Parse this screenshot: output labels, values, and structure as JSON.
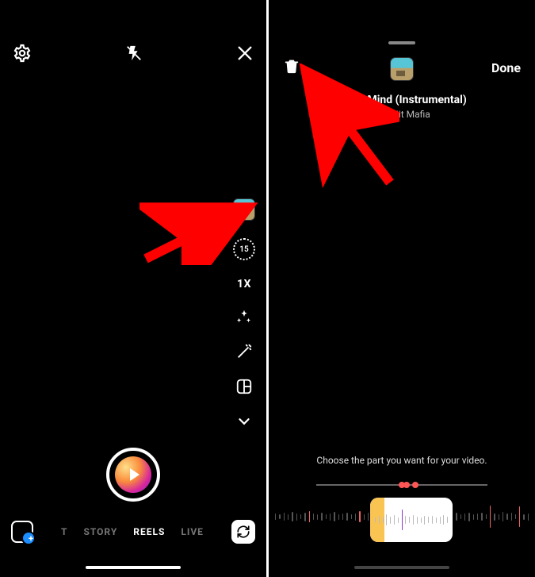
{
  "left": {
    "timer_label": "15",
    "speed_label": "1X",
    "modes": {
      "post": "T",
      "story": "STORY",
      "reels": "REELS",
      "live": "LIVE"
    }
  },
  "right": {
    "done_label": "Done",
    "song_title": "In My Mind (Instrumental)",
    "song_artist": "The Hit Mafia",
    "instruction": "Choose the part you want for your video."
  }
}
